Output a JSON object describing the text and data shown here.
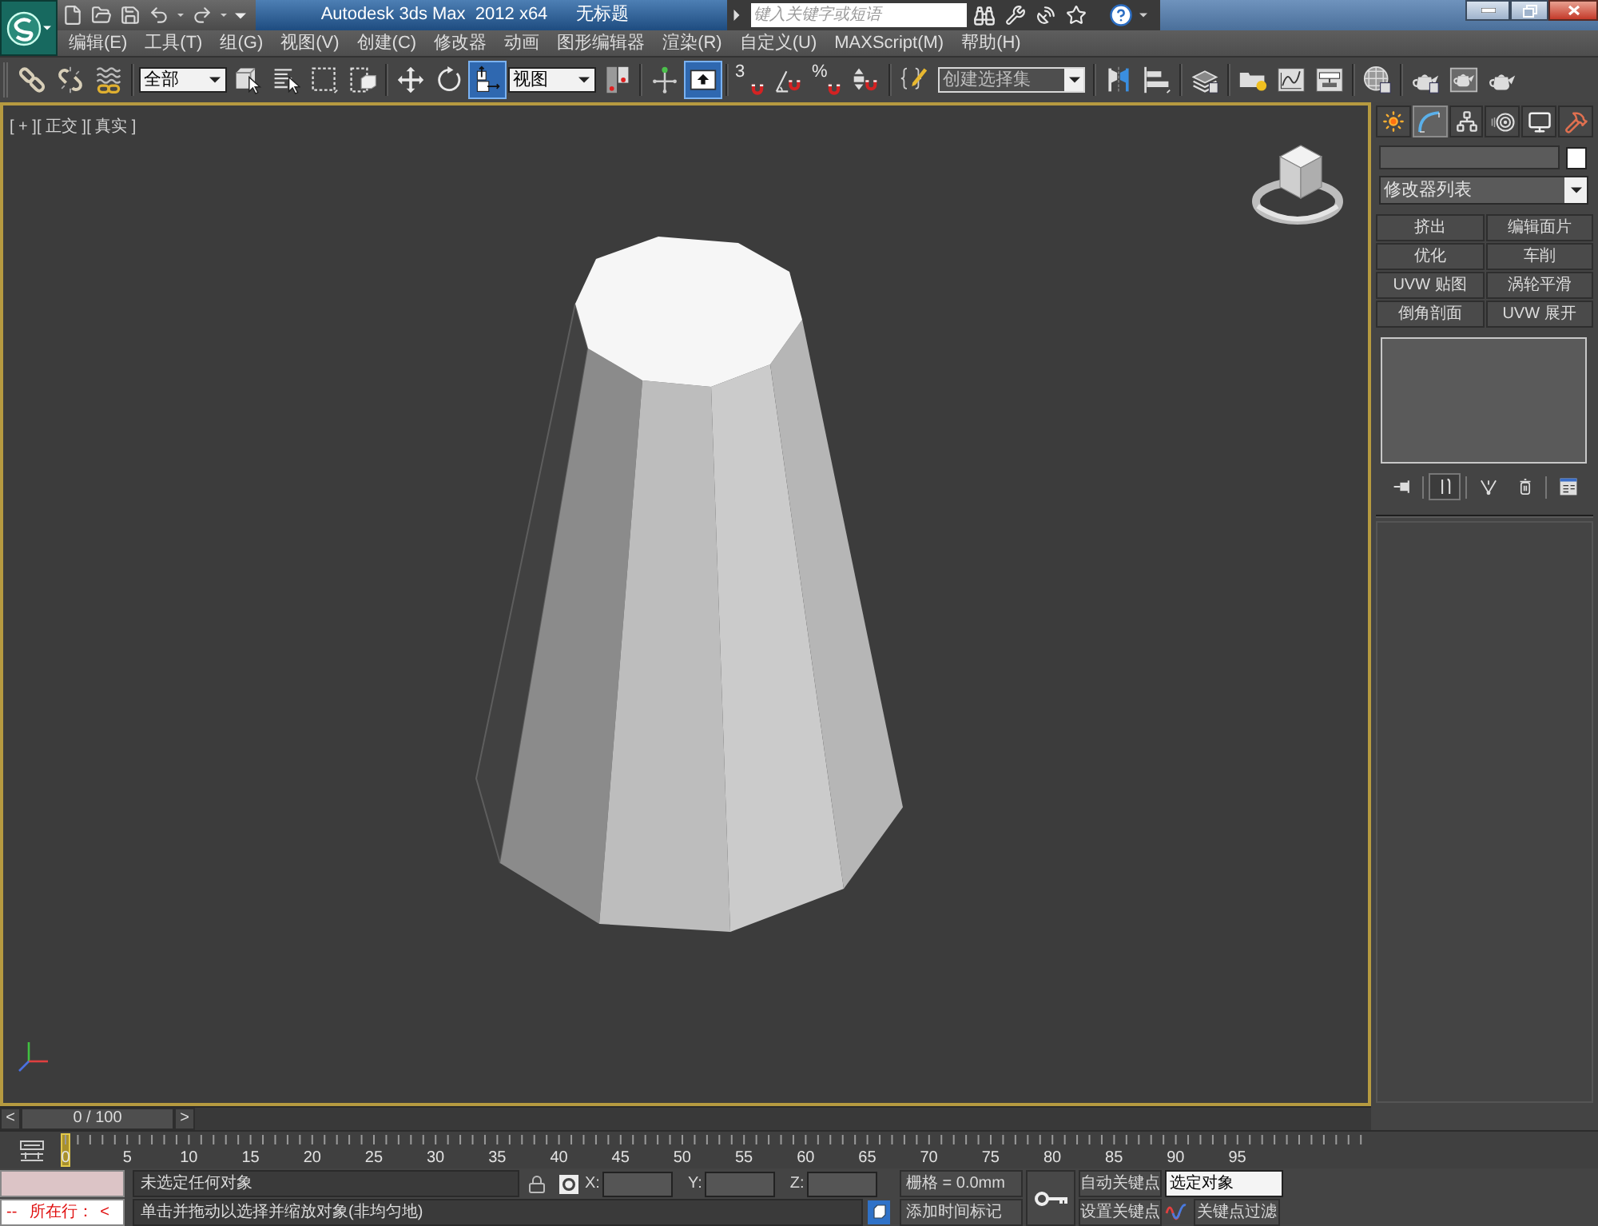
{
  "title_bar": {
    "title": "Autodesk 3ds Max  2012 x64",
    "document": "无标题",
    "search": {
      "placeholder": "键入关键字或短语"
    }
  },
  "menu_bar": [
    "编辑(E)",
    "工具(T)",
    "组(G)",
    "视图(V)",
    "创建(C)",
    "修改器",
    "动画",
    "图形编辑器",
    "渲染(R)",
    "自定义(U)",
    "MAXScript(M)",
    "帮助(H)"
  ],
  "main_toolbar": [
    {
      "kind": "button",
      "selected": false
    },
    {
      "kind": "button",
      "selected": false
    },
    {
      "kind": "button",
      "selected": false
    },
    {
      "kind": "separator"
    },
    {
      "kind": "dropdown",
      "value": "全部"
    },
    {
      "kind": "button",
      "selected": false
    },
    {
      "kind": "button",
      "selected": false
    },
    {
      "kind": "button",
      "selected": false
    },
    {
      "kind": "button",
      "selected": false
    },
    {
      "kind": "separator"
    },
    {
      "kind": "button",
      "selected": false
    },
    {
      "kind": "button",
      "selected": false
    },
    {
      "kind": "button",
      "selected": true
    },
    {
      "kind": "dropdown",
      "value": "视图"
    },
    {
      "kind": "button",
      "selected": false
    },
    {
      "kind": "separator"
    },
    {
      "kind": "button",
      "selected": false
    },
    {
      "kind": "button",
      "selected": true
    },
    {
      "kind": "separator"
    },
    {
      "kind": "button",
      "selected": false,
      "label": "3"
    },
    {
      "kind": "button",
      "selected": false
    },
    {
      "kind": "button",
      "selected": false,
      "label": "%"
    },
    {
      "kind": "button",
      "selected": false
    },
    {
      "kind": "separator"
    },
    {
      "kind": "button",
      "selected": false
    },
    {
      "kind": "combo",
      "placeholder": "创建选择集"
    },
    {
      "kind": "separator"
    },
    {
      "kind": "button",
      "selected": false
    },
    {
      "kind": "button",
      "selected": false
    },
    {
      "kind": "separator"
    },
    {
      "kind": "button",
      "selected": false
    },
    {
      "kind": "separator"
    },
    {
      "kind": "button",
      "selected": false
    },
    {
      "kind": "button",
      "selected": false
    },
    {
      "kind": "button",
      "selected": false
    },
    {
      "kind": "separator"
    },
    {
      "kind": "button",
      "selected": false
    },
    {
      "kind": "separator"
    },
    {
      "kind": "button",
      "selected": false
    },
    {
      "kind": "button",
      "selected": false
    },
    {
      "kind": "button",
      "selected": false
    }
  ],
  "viewport": {
    "label": "[ + ][ 正交 ][ 真实 ]",
    "active": true
  },
  "command_panel": {
    "tabs": [
      {
        "selected": false
      },
      {
        "selected": true
      },
      {
        "selected": false
      },
      {
        "selected": false
      },
      {
        "selected": false
      },
      {
        "selected": false
      }
    ],
    "modifier_list": "修改器列表",
    "modifier_buttons": [
      "挤出",
      "编辑面片",
      "优化",
      "车削",
      "UVW 贴图",
      "涡轮平滑",
      "倒角剖面",
      "UVW 展开"
    ],
    "stack_toolbar": [
      {
        "selected": false
      },
      {
        "selected": true
      },
      {
        "selected": false
      },
      {
        "selected": false
      },
      {
        "selected": false
      }
    ]
  },
  "time_slider": {
    "prev": "<",
    "position": "0 / 100",
    "next": ">",
    "level": 0
  },
  "track_bar": {
    "labels": [
      "0",
      "5",
      "10",
      "15",
      "20",
      "25",
      "30",
      "35",
      "40",
      "45",
      "50",
      "55",
      "60",
      "65",
      "70",
      "75",
      "80",
      "85",
      "90",
      "95"
    ]
  },
  "maxscript_listener": {
    "marker": "--",
    "line_label": "所在行：",
    "cut_text": "<"
  },
  "status_bar": {
    "selection": "未选定任何对象",
    "prompt": "单击并拖动以选择并缩放对象(非均匀地)",
    "coords": [
      {
        "label": "X:"
      },
      {
        "label": "Y:"
      },
      {
        "label": "Z:"
      }
    ],
    "grid": "栅格 = 0.0mm",
    "add_time_tag": "添加时间标记",
    "auto_key": "自动关键点",
    "set_key": "设置关键点",
    "selection_set": "选定对象",
    "key_filters": "关键点过滤"
  }
}
